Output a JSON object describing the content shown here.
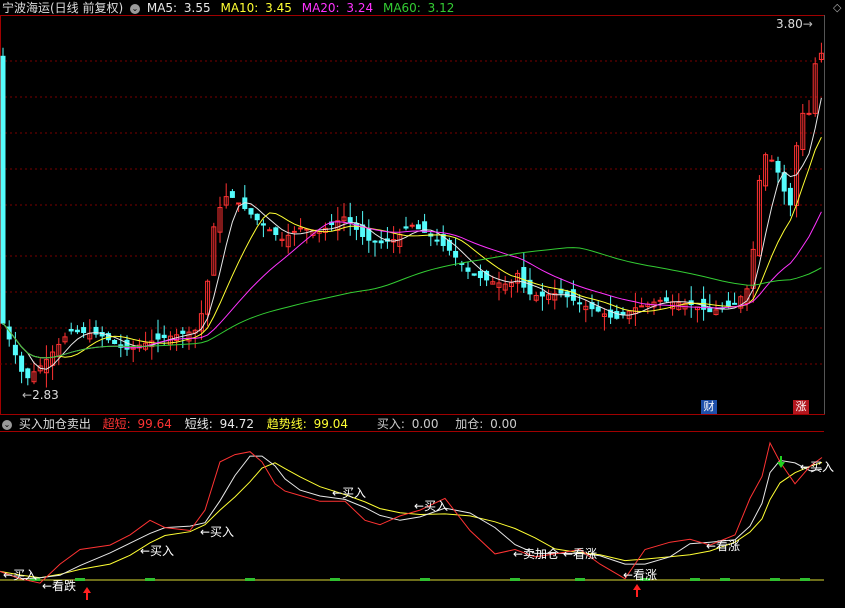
{
  "main_panel": {
    "stock_name": "宁波海运(日线 前复权)",
    "ma": [
      {
        "label": "MA5:",
        "value": "3.55",
        "color": "#e8e8e8"
      },
      {
        "label": "MA10:",
        "value": "3.45",
        "color": "#ffff33"
      },
      {
        "label": "MA20:",
        "value": "3.24",
        "color": "#ff33ff"
      },
      {
        "label": "MA60:",
        "value": "3.12",
        "color": "#33cc33"
      }
    ],
    "high_label": "3.80",
    "low_label": "2.83",
    "badges": [
      {
        "text": "财",
        "color": "#1e4fa8"
      },
      {
        "text": "涨",
        "color": "#b3161e"
      }
    ]
  },
  "indicator_panel": {
    "name": "买入加仓卖出",
    "values": [
      {
        "label": "超短:",
        "value": "99.64",
        "color": "#ff3333"
      },
      {
        "label": "短线:",
        "value": "94.72",
        "color": "#e8e8e8"
      },
      {
        "label": "趋势线:",
        "value": "99.04",
        "color": "#ffff33"
      },
      {
        "label": "买入:",
        "value": "0.00",
        "color": "#cccccc"
      },
      {
        "label": "加仓:",
        "value": "0.00",
        "color": "#cccccc"
      }
    ],
    "signals": [
      "买入",
      "看跌",
      "买入",
      "买入",
      "买入",
      "买入",
      "卖加仓",
      "看涨",
      "看涨",
      "看涨",
      "买入"
    ]
  },
  "colors": {
    "up": "#ff3232",
    "down": "#54fcfc",
    "grid": "#7a0000",
    "frame": "#a00000"
  }
}
